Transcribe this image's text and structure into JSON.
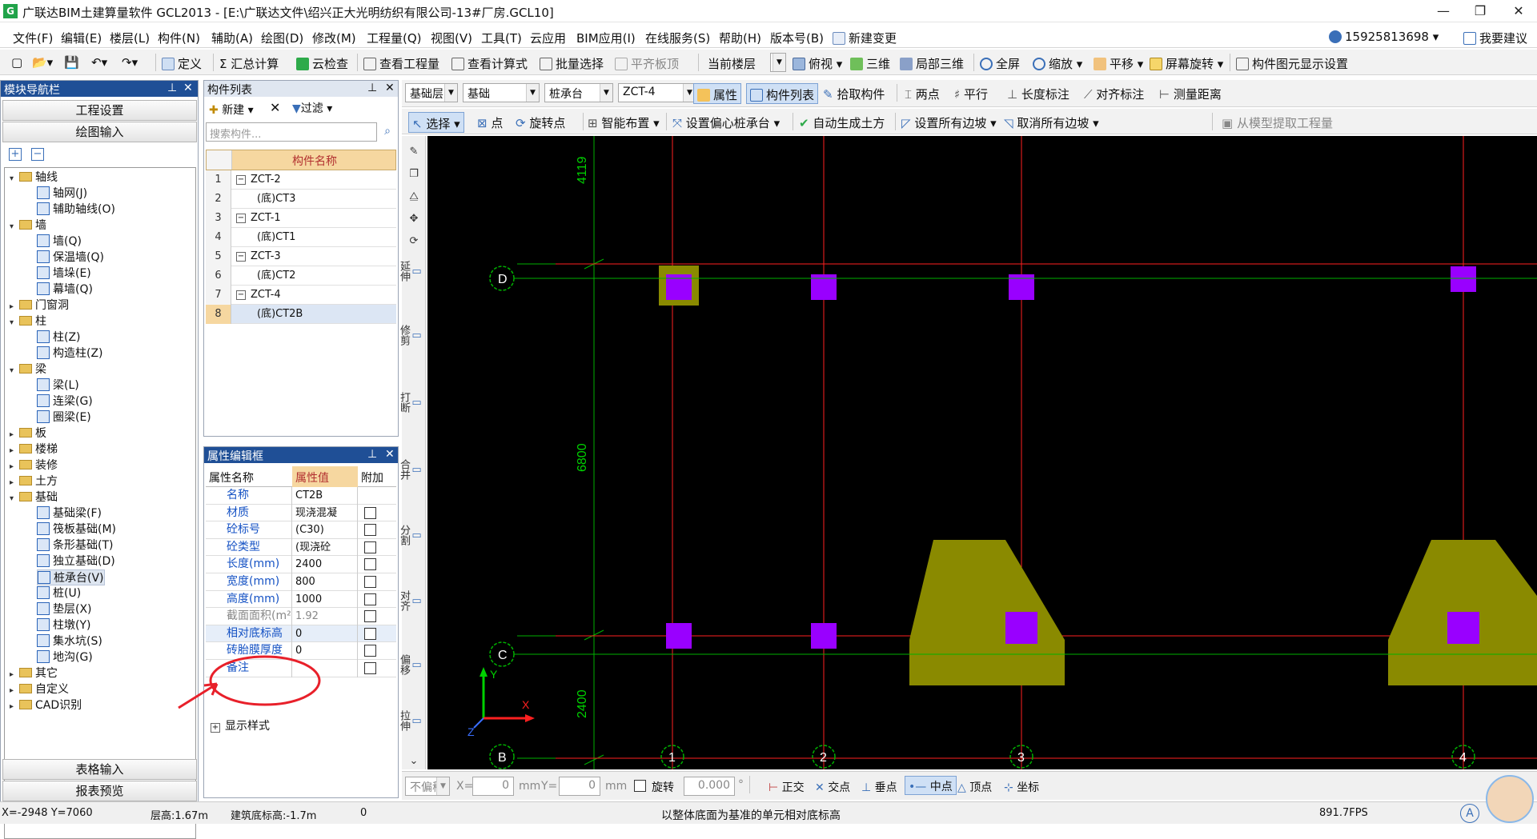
{
  "window": {
    "title": "广联达BIM土建算量软件 GCL2013 - [E:\\广联达文件\\绍兴正大光明纺织有限公司-13#厂房.GCL10]",
    "app_icon": "G",
    "minimize": "—",
    "restore": "❐",
    "close": "✕"
  },
  "menubar": {
    "items": [
      "文件(F)",
      "编辑(E)",
      "楼层(L)",
      "构件(N)",
      "辅助(A)",
      "绘图(D)",
      "修改(M)",
      "工程量(Q)",
      "视图(V)",
      "工具(T)",
      "云应用",
      "BIM应用(I)",
      "在线服务(S)",
      "帮助(H)",
      "版本号(B)",
      "新建变更"
    ],
    "user": "15925813698",
    "suggest": "我要建议"
  },
  "toolbar1": {
    "define": "定义",
    "sum": "汇总计算",
    "cloud_check": "云检查",
    "view_qty": "查看工程量",
    "view_formula": "查看计算式",
    "batch_select": "批量选择",
    "flat_board": "平齐板顶",
    "current_floor": "当前楼层",
    "top_view": "俯视",
    "three_d": "三维",
    "local_3d": "局部三维",
    "fullscreen": "全屏",
    "zoom": "缩放",
    "pan": "平移",
    "rotate_screen": "屏幕旋转",
    "display_settings": "构件图元显示设置"
  },
  "toolbar2": {
    "floor": "基础层",
    "category": "基础",
    "type": "桩承台",
    "component": "ZCT-4",
    "property": "属性",
    "comp_list": "构件列表",
    "pick": "拾取构件",
    "two_points": "两点",
    "parallel": "平行",
    "length_dim": "长度标注",
    "align_dim": "对齐标注",
    "measure": "测量距离"
  },
  "toolbar3": {
    "select": "选择",
    "point": "点",
    "rotate_point": "旋转点",
    "smart_layout": "智能布置",
    "offset_cap": "设置偏心桩承台",
    "auto_earth": "自动生成土方",
    "set_slopes": "设置所有边坡",
    "cancel_slopes": "取消所有边坡",
    "extract_qty": "从模型提取工程量"
  },
  "nav": {
    "title": "模块导航栏",
    "project_settings": "工程设置",
    "drawing_input": "绘图输入",
    "table_input": "表格输入",
    "report_preview": "报表预览",
    "tree": [
      {
        "label": "轴线",
        "level": 0,
        "kind": "folder",
        "expanded": true
      },
      {
        "label": "轴网(J)",
        "level": 1,
        "kind": "leaf"
      },
      {
        "label": "辅助轴线(O)",
        "level": 1,
        "kind": "leaf"
      },
      {
        "label": "墙",
        "level": 0,
        "kind": "folder",
        "expanded": true
      },
      {
        "label": "墙(Q)",
        "level": 1,
        "kind": "leaf"
      },
      {
        "label": "保温墙(Q)",
        "level": 1,
        "kind": "leaf"
      },
      {
        "label": "墙垛(E)",
        "level": 1,
        "kind": "leaf"
      },
      {
        "label": "幕墙(Q)",
        "level": 1,
        "kind": "leaf"
      },
      {
        "label": "门窗洞",
        "level": 0,
        "kind": "folder",
        "expanded": false
      },
      {
        "label": "柱",
        "level": 0,
        "kind": "folder",
        "expanded": true
      },
      {
        "label": "柱(Z)",
        "level": 1,
        "kind": "leaf"
      },
      {
        "label": "构造柱(Z)",
        "level": 1,
        "kind": "leaf"
      },
      {
        "label": "梁",
        "level": 0,
        "kind": "folder",
        "expanded": true
      },
      {
        "label": "梁(L)",
        "level": 1,
        "kind": "leaf"
      },
      {
        "label": "连梁(G)",
        "level": 1,
        "kind": "leaf"
      },
      {
        "label": "圈梁(E)",
        "level": 1,
        "kind": "leaf"
      },
      {
        "label": "板",
        "level": 0,
        "kind": "folder",
        "expanded": false
      },
      {
        "label": "楼梯",
        "level": 0,
        "kind": "folder",
        "expanded": false
      },
      {
        "label": "装修",
        "level": 0,
        "kind": "folder",
        "expanded": false
      },
      {
        "label": "土方",
        "level": 0,
        "kind": "folder",
        "expanded": false
      },
      {
        "label": "基础",
        "level": 0,
        "kind": "folder",
        "expanded": true
      },
      {
        "label": "基础梁(F)",
        "level": 1,
        "kind": "leaf"
      },
      {
        "label": "筏板基础(M)",
        "level": 1,
        "kind": "leaf"
      },
      {
        "label": "条形基础(T)",
        "level": 1,
        "kind": "leaf"
      },
      {
        "label": "独立基础(D)",
        "level": 1,
        "kind": "leaf"
      },
      {
        "label": "桩承台(V)",
        "level": 1,
        "kind": "leaf",
        "selected": true
      },
      {
        "label": "桩(U)",
        "level": 1,
        "kind": "leaf"
      },
      {
        "label": "垫层(X)",
        "level": 1,
        "kind": "leaf"
      },
      {
        "label": "柱墩(Y)",
        "level": 1,
        "kind": "leaf"
      },
      {
        "label": "集水坑(S)",
        "level": 1,
        "kind": "leaf"
      },
      {
        "label": "地沟(G)",
        "level": 1,
        "kind": "leaf"
      },
      {
        "label": "其它",
        "level": 0,
        "kind": "folder",
        "expanded": false
      },
      {
        "label": "自定义",
        "level": 0,
        "kind": "folder",
        "expanded": false
      },
      {
        "label": "CAD识别",
        "level": 0,
        "kind": "folder",
        "expanded": false
      }
    ]
  },
  "component_list": {
    "title": "构件列表",
    "new": "新建",
    "filter": "过滤",
    "search_placeholder": "搜索构件...",
    "column": "构件名称",
    "rows": [
      {
        "n": "1",
        "label": "ZCT-2",
        "child": false
      },
      {
        "n": "2",
        "label": "(底)CT3",
        "child": true
      },
      {
        "n": "3",
        "label": "ZCT-1",
        "child": false
      },
      {
        "n": "4",
        "label": "(底)CT1",
        "child": true
      },
      {
        "n": "5",
        "label": "ZCT-3",
        "child": false
      },
      {
        "n": "6",
        "label": "(底)CT2",
        "child": true
      },
      {
        "n": "7",
        "label": "ZCT-4",
        "child": false
      },
      {
        "n": "8",
        "label": "(底)CT2B",
        "child": true,
        "selected": true
      }
    ]
  },
  "properties": {
    "title": "属性编辑框",
    "col_name": "属性名称",
    "col_value": "属性值",
    "col_extra": "附加",
    "rows": [
      {
        "name": "名称",
        "value": "CT2B",
        "check": false
      },
      {
        "name": "材质",
        "value": "现浇混凝",
        "check": true
      },
      {
        "name": "砼标号",
        "value": "(C30)",
        "check": true
      },
      {
        "name": "砼类型",
        "value": "(现浇砼",
        "check": true
      },
      {
        "name": "长度(mm)",
        "value": "2400",
        "check": true
      },
      {
        "name": "宽度(mm)",
        "value": "800",
        "check": true
      },
      {
        "name": "高度(mm)",
        "value": "1000",
        "check": true
      },
      {
        "name": "截面面积(m²)",
        "value": "1.92",
        "check": true,
        "gray": true
      },
      {
        "name": "相对底标高",
        "value": "0",
        "check": true,
        "highlight": true
      },
      {
        "name": "砖胎膜厚度",
        "value": "0",
        "check": true
      },
      {
        "name": "备注",
        "value": "",
        "check": true
      }
    ],
    "display_style": "显示样式"
  },
  "vertical_tools": [
    "延伸",
    "修剪",
    "打断",
    "合并",
    "分割",
    "对齐",
    "偏移",
    "拉伸"
  ],
  "canvas": {
    "dim_top": "4119",
    "dim_mid": "6800",
    "dim_bottom": "2400",
    "axis_labels_v": [
      "1",
      "2",
      "3",
      "4"
    ],
    "axis_labels_h": [
      "D",
      "C",
      "B"
    ],
    "axis_x_label": "X",
    "axis_y_label": "Y",
    "axis_z_label": "Z",
    "colors": {
      "background": "#000000",
      "axis_line": "#ff2020",
      "cap": "#8a8a00",
      "pile": "#9900ff",
      "green": "#00b000",
      "highlight": "#ff2020"
    }
  },
  "bottom_bar": {
    "no_offset": "不偏移",
    "x_label": "X=",
    "x_value": "0",
    "unit1": "mm",
    "y_label": "Y=",
    "y_value": "0",
    "unit2": "mm",
    "rotate": "旋转",
    "angle": "0.000",
    "deg": "°",
    "ortho": "正交",
    "intersect": "交点",
    "perp": "垂点",
    "mid": "中点",
    "vertex": "顶点",
    "coord": "坐标"
  },
  "status": {
    "coords": "X=-2948 Y=7060",
    "floor_height": "层高:1.67m",
    "bottom_elev": "建筑底标高:-1.7m",
    "zero": "0",
    "hint": "以整体底面为基准的单元相对底标高",
    "fps": "891.7FPS"
  }
}
